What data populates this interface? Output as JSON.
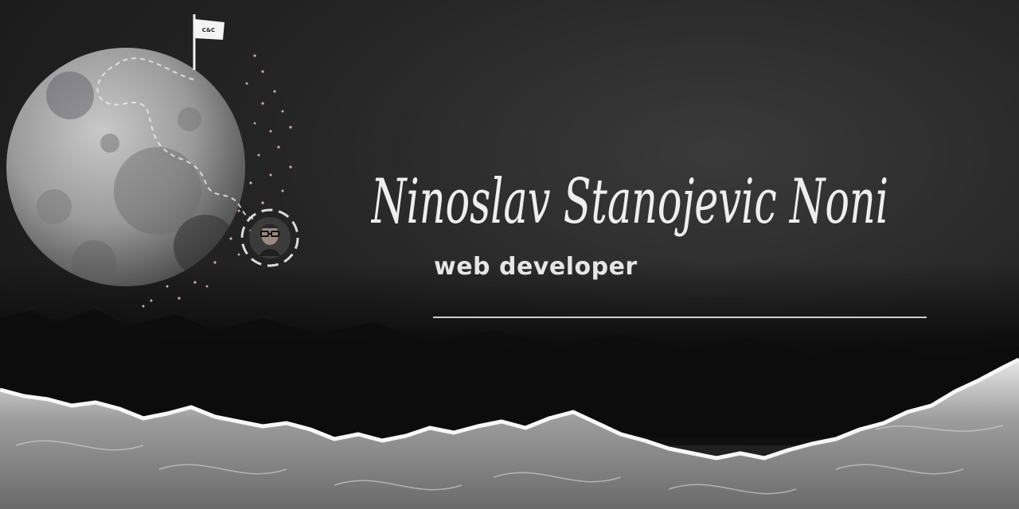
{
  "hero": {
    "name": "Ninoslav Stanojevic Noni",
    "role": "web developer",
    "flag_text": "C&C"
  },
  "icons": {
    "moon": "moon-illustration",
    "flag": "flag-icon",
    "avatar": "avatar-photo"
  },
  "colors": {
    "background": "#1c1c1c",
    "text": "#e6e6e6",
    "accent_dots": "#d9a7ad"
  }
}
